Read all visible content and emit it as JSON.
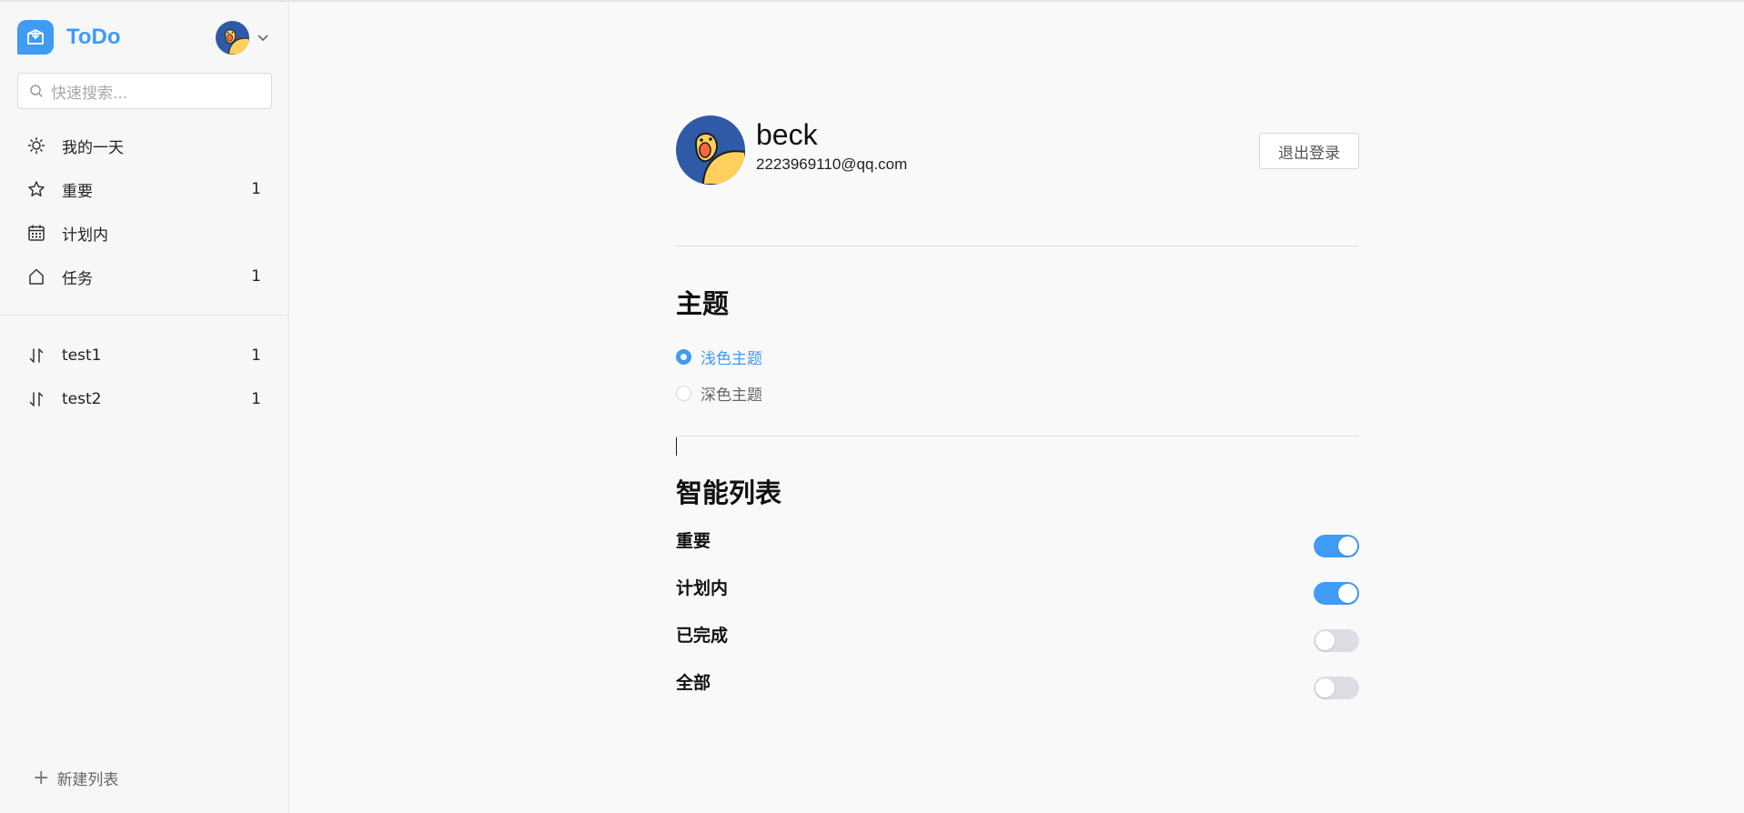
{
  "app": {
    "name": "ToDo"
  },
  "search": {
    "placeholder": "快速搜索..."
  },
  "nav": [
    {
      "label": "我的一天",
      "count": "",
      "icon": "sun-icon"
    },
    {
      "label": "重要",
      "count": "1",
      "icon": "star-icon"
    },
    {
      "label": "计划内",
      "count": "",
      "icon": "calendar-icon"
    },
    {
      "label": "任务",
      "count": "1",
      "icon": "home-icon"
    }
  ],
  "lists": [
    {
      "label": "test1",
      "count": "1",
      "icon": "sort-icon"
    },
    {
      "label": "test2",
      "count": "1",
      "icon": "sort-icon"
    }
  ],
  "new_list": {
    "label": "新建列表"
  },
  "profile": {
    "name": "beck",
    "email": "2223969110@qq.com",
    "logout_label": "退出登录"
  },
  "theme": {
    "title": "主题",
    "options": [
      {
        "label": "浅色主题",
        "selected": true
      },
      {
        "label": "深色主题",
        "selected": false
      }
    ]
  },
  "smart_lists": {
    "title": "智能列表",
    "items": [
      {
        "label": "重要",
        "on": true
      },
      {
        "label": "计划内",
        "on": true
      },
      {
        "label": "已完成",
        "on": false
      },
      {
        "label": "全部",
        "on": false
      }
    ]
  },
  "colors": {
    "accent": "#3f9bf3",
    "toggle_off": "#dcdde2"
  }
}
